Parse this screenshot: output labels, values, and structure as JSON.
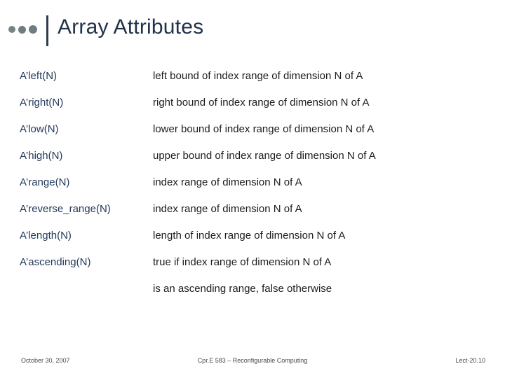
{
  "slide": {
    "title": "Array Attributes",
    "rows": [
      {
        "term": "A’left(N)",
        "desc": "left bound of index range of dimension N of A",
        "wide": false
      },
      {
        "term": "A’right(N)",
        "desc": "right bound of index range of dimension N of A",
        "wide": false
      },
      {
        "term": "A’low(N)",
        "desc": "lower bound of index range of dimension N of A",
        "wide": false
      },
      {
        "term": "A’high(N)",
        "desc": "upper bound of index range of dimension N of A",
        "wide": false
      },
      {
        "term": "A’range(N)",
        "desc": "index range of dimension N of A",
        "wide": false
      },
      {
        "term": "A’reverse_range(N)",
        "desc": "index range of dimension N of A",
        "wide": true
      },
      {
        "term": "A’length(N)",
        "desc": "length of index range of dimension N of A",
        "wide": false
      },
      {
        "term": "A’ascending(N)",
        "desc": "true if index range of dimension N of A",
        "wide": false
      }
    ],
    "continuation": "is an ascending range, false otherwise"
  },
  "footer": {
    "date": "October 30, 2007",
    "center": "Cpr.E 583 – Reconfigurable Computing",
    "lecture": "Lect-20.10"
  }
}
